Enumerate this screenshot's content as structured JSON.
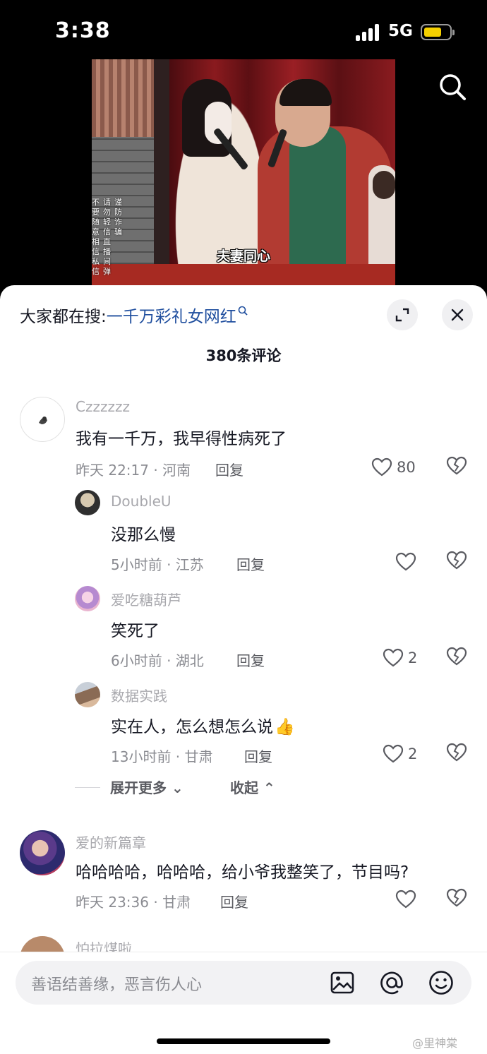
{
  "status_bar": {
    "time": "3:38",
    "network": "5G"
  },
  "video": {
    "subtitle": "夫妻同心",
    "warning_chars": [
      "不",
      "要",
      "随",
      "意",
      "相",
      "信",
      "私",
      "信",
      "请",
      "勿",
      "轻",
      "信",
      "直",
      "播",
      "间",
      "弹",
      "谨",
      "防",
      "诈",
      "骗"
    ]
  },
  "sheet": {
    "trend_prefix": "大家都在搜:",
    "trend_term": "一千万彩礼女网红",
    "comment_count": "380条评论",
    "input_placeholder": "善语结善缘，恶言伤人心",
    "watermark": "@里神棠"
  },
  "comments": [
    {
      "user": "Czzzzzz",
      "text": "我有一千万，我早得性病死了",
      "meta": "昨天 22:17 · 河南",
      "reply": "回复",
      "likes": "80"
    },
    {
      "user": "爱的新篇章",
      "text": "哈哈哈哈，哈哈哈，给小爷我整笑了，节目吗?",
      "meta": "昨天 23:36 · 甘肃",
      "reply": "回复",
      "likes": ""
    },
    {
      "user": "怕拉煤啦"
    }
  ],
  "replies": [
    {
      "user": "DoubleU",
      "text": "没那么慢",
      "meta": "5小时前 · 江苏",
      "reply": "回复",
      "likes": ""
    },
    {
      "user": "爱吃糖葫芦",
      "text": "笑死了",
      "meta": "6小时前 · 湖北",
      "reply": "回复",
      "likes": "2"
    },
    {
      "user": "数据实践",
      "text": "实在人，怎么想怎么说",
      "emoji": "👍",
      "meta": "13小时前 · 甘肃",
      "reply": "回复",
      "likes": "2"
    }
  ],
  "thread_controls": {
    "expand_more": "展开更多",
    "collapse": "收起"
  },
  "icons": {
    "search": "search-icon",
    "expand": "expand-icon",
    "close": "close-icon",
    "like": "heart-icon",
    "dislike": "broken-heart-icon",
    "image": "image-icon",
    "mention": "at-icon",
    "emoji": "smiley-icon"
  },
  "colors": {
    "trend_link": "#1f4e9e",
    "battery": "#f5d000",
    "sheet_bg": "#ffffff"
  }
}
